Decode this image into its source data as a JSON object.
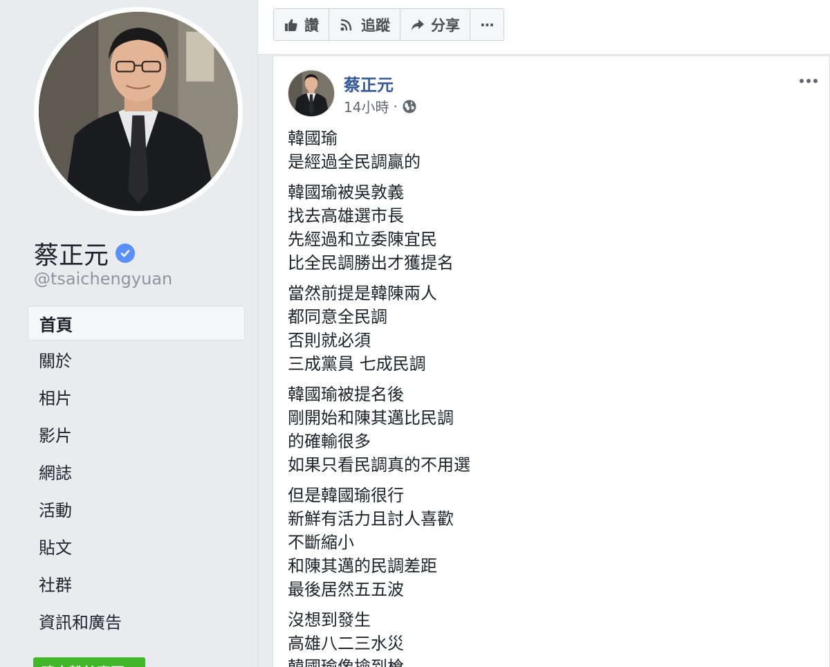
{
  "page": {
    "name": "蔡正元",
    "handle": "@tsaichengyuan"
  },
  "nav": {
    "items": [
      {
        "label": "首頁",
        "active": true
      },
      {
        "label": "關於",
        "active": false
      },
      {
        "label": "相片",
        "active": false
      },
      {
        "label": "影片",
        "active": false
      },
      {
        "label": "網誌",
        "active": false
      },
      {
        "label": "活動",
        "active": false
      },
      {
        "label": "貼文",
        "active": false
      },
      {
        "label": "社群",
        "active": false
      },
      {
        "label": "資訊和廣告",
        "active": false
      }
    ],
    "create_page_label": "建立粉絲專頁"
  },
  "actions": {
    "like": "讚",
    "follow": "追蹤",
    "share": "分享",
    "more": "···"
  },
  "post": {
    "author": "蔡正元",
    "time": "14小時",
    "separator": "·",
    "privacy_icon": "globe-icon",
    "paragraphs": [
      [
        "韓國瑜",
        "是經過全民調贏的"
      ],
      [
        "韓國瑜被吳敦義",
        "找去高雄選市長",
        "先經過和立委陳宜民",
        "比全民調勝出才獲提名"
      ],
      [
        "當然前提是韓陳兩人",
        "都同意全民調",
        "否則就必須",
        "三成黨員 七成民調"
      ],
      [
        "韓國瑜被提名後",
        "剛開始和陳其邁比民調",
        "的確輸很多",
        "如果只看民調真的不用選"
      ],
      [
        "但是韓國瑜很行",
        "新鮮有活力且討人喜歡",
        "不斷縮小",
        "和陳其邁的民調差距",
        "最後居然五五波"
      ],
      [
        "沒想到發生",
        "高雄八二三水災",
        "韓國瑜像撿到槍"
      ]
    ]
  },
  "colors": {
    "background": "#e9ebee",
    "link": "#365899",
    "verified": "#5890ff",
    "create_button": "#42b72a"
  }
}
